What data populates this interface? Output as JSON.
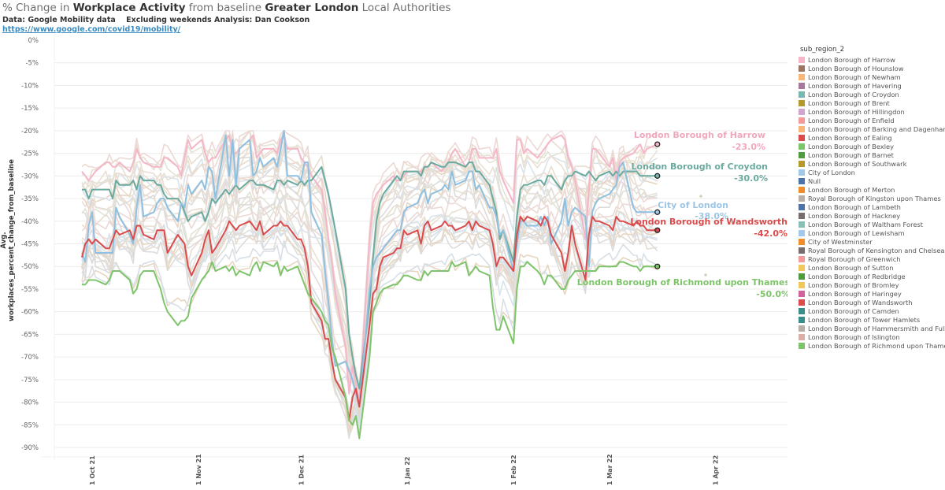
{
  "header": {
    "title_parts": [
      {
        "text": "% Change in ",
        "bold": false
      },
      {
        "text": "Workplace Activity",
        "bold": true
      },
      {
        "text": " from baseline ",
        "bold": false
      },
      {
        "text": "Greater London",
        "bold": true
      },
      {
        "text": " Local Authorities",
        "bold": false
      }
    ],
    "data_source": "Data: Google Mobility data",
    "note": "Excluding weekends Analysis: Dan Cookson",
    "link": "https://www.google.com/covid19/mobility/"
  },
  "legend": {
    "title": "sub_region_2",
    "items": [
      {
        "label": "London Borough of Harrow",
        "color": "#f4b6c8"
      },
      {
        "label": "London Borough of Hounslow",
        "color": "#9c7560"
      },
      {
        "label": "London Borough of Newham",
        "color": "#f8b679"
      },
      {
        "label": "London Borough of Havering",
        "color": "#a6799c"
      },
      {
        "label": "London Borough of Croydon",
        "color": "#79b8b1"
      },
      {
        "label": "London Borough of Brent",
        "color": "#b49a2a"
      },
      {
        "label": "London Borough of Hillingdon",
        "color": "#d1a6cc"
      },
      {
        "label": "London Borough of Enfield",
        "color": "#f59a9a"
      },
      {
        "label": "London Borough of Barking and Dagenham",
        "color": "#f8b679"
      },
      {
        "label": "London Borough of Ealing",
        "color": "#dc4b4b"
      },
      {
        "label": "London Borough of Bexley",
        "color": "#7dc46a"
      },
      {
        "label": "London Borough of Barnet",
        "color": "#4f9c3f"
      },
      {
        "label": "London Borough of Southwark",
        "color": "#b49a2a"
      },
      {
        "label": "City of London",
        "color": "#a1c9ea"
      },
      {
        "label": "Null",
        "color": "#4c72a8"
      },
      {
        "label": "London Borough of Merton",
        "color": "#f28d2c"
      },
      {
        "label": "Royal Borough of Kingston upon Thames",
        "color": "#b9afa9"
      },
      {
        "label": "London Borough of Lambeth",
        "color": "#4c72a8"
      },
      {
        "label": "London Borough of Hackney",
        "color": "#766e6c"
      },
      {
        "label": "London Borough of Waltham Forest",
        "color": "#89c0b5"
      },
      {
        "label": "London Borough of Lewisham",
        "color": "#a1c9ea"
      },
      {
        "label": "City of Westminster",
        "color": "#f28d2c"
      },
      {
        "label": "Royal Borough of Kensington and Chelsea",
        "color": "#766e6c"
      },
      {
        "label": "Royal Borough of Greenwich",
        "color": "#f59a9a"
      },
      {
        "label": "London Borough of Sutton",
        "color": "#f0c95a"
      },
      {
        "label": "London Borough of Redbridge",
        "color": "#4f9c3f"
      },
      {
        "label": "London Borough of Bromley",
        "color": "#f0c95a"
      },
      {
        "label": "London Borough of Haringey",
        "color": "#d1639a"
      },
      {
        "label": "London Borough of Wandsworth",
        "color": "#dc4b4b"
      },
      {
        "label": "London Borough of Camden",
        "color": "#3a8e8a"
      },
      {
        "label": "London Borough of Tower Hamlets",
        "color": "#3a8e8a"
      },
      {
        "label": "London Borough of Hammersmith and Fulham",
        "color": "#b9afa9"
      },
      {
        "label": "London Borough of Islington",
        "color": "#d8b0a8"
      },
      {
        "label": "London Borough of Richmond upon Thames",
        "color": "#7dc46a"
      }
    ]
  },
  "chart_data": {
    "type": "line",
    "title": "% Change in Workplace Activity from baseline Greater London Local Authorities",
    "xlabel": "",
    "ylabel": "Avg. workplaces_percent_change_from_baseline",
    "ylim": [
      -90,
      0
    ],
    "yticks": [
      0,
      -5,
      -10,
      -15,
      -20,
      -25,
      -30,
      -35,
      -40,
      -45,
      -50,
      -55,
      -60,
      -65,
      -70,
      -75,
      -80,
      -85,
      -90
    ],
    "ytick_labels": [
      "0%",
      "-5%",
      "-10%",
      "-15%",
      "-20%",
      "-25%",
      "-30%",
      "-35%",
      "-40%",
      "-45%",
      "-50%",
      "-55%",
      "-60%",
      "-65%",
      "-70%",
      "-75%",
      "-80%",
      "-85%",
      "-90%"
    ],
    "xlim_days": [
      -10,
      205
    ],
    "xticks_days": [
      0,
      31,
      61,
      92,
      123,
      151,
      182
    ],
    "xtick_labels": [
      "1 Oct 21",
      "1 Nov 21",
      "1 Dec 21",
      "1 Jan 22",
      "1 Feb 22",
      "1 Mar 22",
      "1 Apr 22"
    ],
    "x_day_note": "days since 1 Oct 2021",
    "grid": true,
    "legend_position": "right",
    "x": [
      -3,
      -2,
      -1,
      0,
      1,
      4,
      5,
      6,
      7,
      8,
      11,
      12,
      13,
      14,
      15,
      18,
      19,
      20,
      21,
      22,
      25,
      26,
      27,
      28,
      29,
      32,
      33,
      34,
      35,
      36,
      39,
      40,
      41,
      42,
      43,
      46,
      47,
      48,
      49,
      50,
      53,
      54,
      55,
      56,
      57,
      60,
      61,
      62,
      63,
      64,
      67,
      68,
      69,
      70,
      71,
      74,
      75,
      76,
      77,
      78,
      81,
      82,
      83,
      84,
      85,
      88,
      89,
      90,
      91,
      92,
      95,
      96,
      97,
      98,
      99,
      102,
      103,
      104,
      105,
      106,
      109,
      110,
      111,
      112,
      113,
      116,
      117,
      118,
      119,
      120,
      123,
      124,
      125,
      126,
      127,
      130,
      131,
      132,
      133,
      134,
      137,
      138,
      139,
      140,
      141,
      144,
      145,
      146,
      147,
      148,
      151,
      152,
      153,
      154,
      155,
      158,
      159,
      160,
      161,
      162,
      165
    ],
    "series": [
      {
        "name": "London Borough of Harrow",
        "highlight": true,
        "color": "#f4b6c8",
        "end_label": "-23.0%",
        "values": [
          -29,
          -30,
          -31,
          -30,
          -29,
          -27,
          -27,
          -28,
          -28,
          -27,
          -29,
          -27,
          -24,
          -26,
          -27,
          -28,
          -28,
          -28,
          -26,
          -26,
          -28,
          -30,
          -26,
          -22,
          -24,
          -22,
          -25,
          -27,
          -26,
          -26,
          -22,
          -21,
          -25,
          -25,
          -24,
          -22,
          -21,
          -26,
          -25,
          -24,
          -24,
          -25,
          -22,
          -21,
          -24,
          -24,
          -26,
          -27,
          -28,
          -30,
          -33,
          -38,
          -44,
          -49,
          -56,
          -68,
          -78,
          -72,
          -76,
          -80,
          -44,
          -36,
          -34,
          -33,
          -32,
          -30,
          -31,
          -31,
          -30,
          -29,
          -29,
          -29,
          -28,
          -28,
          -27,
          -29,
          -28,
          -27,
          -25,
          -24,
          -28,
          -27,
          -24,
          -24,
          -26,
          -26,
          -26,
          -24,
          -29,
          -31,
          -36,
          -22,
          -22,
          -25,
          -24,
          -26,
          -25,
          -24,
          -23,
          -22,
          -21,
          -22,
          -26,
          -28,
          -31,
          -44,
          -33,
          -24,
          -24,
          -25,
          -28,
          -26,
          -31,
          -27,
          -26,
          -25,
          -24,
          -23,
          -25,
          -24,
          -23
        ]
      },
      {
        "name": "London Borough of Croydon",
        "highlight": true,
        "color": "#79b8b1",
        "end_label": "-30.0%",
        "values": [
          -33,
          -33,
          -35,
          -33,
          -33,
          -33,
          -33,
          -35,
          -31,
          -32,
          -32,
          -31,
          -33,
          -30,
          -31,
          -31,
          -32,
          -32,
          -34,
          -35,
          -35,
          -36,
          -38,
          -40,
          -39,
          -38,
          -40,
          -38,
          -35,
          -36,
          -33,
          -34,
          -33,
          -32,
          -33,
          -31,
          -31,
          -32,
          -32,
          -32,
          -33,
          -31,
          -31,
          -32,
          -31,
          -32,
          -31,
          -32,
          -31,
          -31,
          -28,
          -31,
          -34,
          -38,
          -42,
          -55,
          -65,
          -70,
          -74,
          -77,
          -58,
          -48,
          -40,
          -36,
          -34,
          -31,
          -30,
          -31,
          -29,
          -29,
          -29,
          -30,
          -28,
          -28,
          -27,
          -28,
          -28,
          -27,
          -27,
          -27,
          -28,
          -27,
          -27,
          -29,
          -29,
          -32,
          -35,
          -38,
          -44,
          -42,
          -49,
          -39,
          -33,
          -32,
          -32,
          -31,
          -31,
          -32,
          -30,
          -30,
          -33,
          -31,
          -30,
          -30,
          -29,
          -30,
          -29,
          -30,
          -31,
          -30,
          -29,
          -30,
          -29,
          -30,
          -29,
          -29,
          -29,
          -30,
          -30,
          -30,
          -30
        ]
      },
      {
        "name": "City of London",
        "highlight": true,
        "color": "#a1c9ea",
        "end_label": "-38.0%",
        "values": [
          -47,
          -49,
          -41,
          -38,
          -47,
          -47,
          -47,
          -47,
          -37,
          -39,
          -43,
          -45,
          -37,
          -32,
          -39,
          -38,
          -36,
          -35,
          -35,
          -37,
          -40,
          -36,
          -37,
          -32,
          -34,
          -31,
          -33,
          -28,
          -29,
          -35,
          -21,
          -30,
          -22,
          -32,
          -24,
          -22,
          -30,
          -29,
          -26,
          -28,
          -26,
          -28,
          -24,
          -20,
          -30,
          -30,
          -31,
          -27,
          -27,
          -38,
          -43,
          -51,
          -58,
          -66,
          -72,
          -71,
          -73,
          -75,
          -78,
          -81,
          -55,
          -50,
          -48,
          -47,
          -46,
          -43,
          -42,
          -42,
          -38,
          -37,
          -36,
          -34,
          -33,
          -36,
          -34,
          -33,
          -32,
          -33,
          -29,
          -32,
          -31,
          -29,
          -29,
          -33,
          -32,
          -37,
          -37,
          -39,
          -43,
          -42,
          -51,
          -45,
          -40,
          -40,
          -41,
          -41,
          -39,
          -41,
          -39,
          -45,
          -40,
          -35,
          -41,
          -38,
          -37,
          -39,
          -50,
          -38,
          -36,
          -35,
          -34,
          -33,
          -32,
          -28,
          -27,
          -37,
          -38,
          -38,
          -38,
          -38,
          -38
        ]
      },
      {
        "name": "London Borough of Wandsworth",
        "highlight": true,
        "color": "#dc4b4b",
        "end_label": "-42.0%",
        "values": [
          -48,
          -45,
          -44,
          -45,
          -44,
          -46,
          -46,
          -44,
          -42,
          -43,
          -42,
          -44,
          -41,
          -41,
          -43,
          -44,
          -42,
          -42,
          -42,
          -47,
          -43,
          -44,
          -45,
          -50,
          -52,
          -47,
          -44,
          -42,
          -47,
          -46,
          -42,
          -40,
          -41,
          -42,
          -41,
          -40,
          -41,
          -42,
          -40,
          -43,
          -41,
          -41,
          -40,
          -41,
          -41,
          -44,
          -44,
          -46,
          -50,
          -58,
          -62,
          -66,
          -66,
          -71,
          -75,
          -79,
          -84,
          -79,
          -77,
          -81,
          -63,
          -56,
          -55,
          -50,
          -48,
          -47,
          -46,
          -46,
          -42,
          -43,
          -42,
          -45,
          -41,
          -40,
          -42,
          -41,
          -40,
          -41,
          -41,
          -42,
          -41,
          -40,
          -42,
          -40,
          -41,
          -42,
          -45,
          -50,
          -48,
          -48,
          -51,
          -43,
          -39,
          -40,
          -39,
          -40,
          -41,
          -39,
          -40,
          -43,
          -47,
          -51,
          -47,
          -41,
          -45,
          -53,
          -43,
          -39,
          -40,
          -40,
          -41,
          -42,
          -39,
          -40,
          -40,
          -41,
          -40,
          -41,
          -41,
          -42,
          -42
        ]
      },
      {
        "name": "London Borough of Richmond upon Thames",
        "highlight": true,
        "color": "#7dc46a",
        "end_label": "-50.0%",
        "values": [
          -54,
          -54,
          -53,
          -53,
          -53,
          -54,
          -53,
          -51,
          -51,
          -51,
          -53,
          -56,
          -55,
          -52,
          -51,
          -51,
          -53,
          -55,
          -58,
          -60,
          -63,
          -62,
          -62,
          -61,
          -57,
          -53,
          -52,
          -51,
          -49,
          -51,
          -50,
          -51,
          -50,
          -52,
          -51,
          -52,
          -50,
          -49,
          -51,
          -49,
          -50,
          -49,
          -52,
          -50,
          -51,
          -50,
          -52,
          -54,
          -56,
          -57,
          -60,
          -62,
          -63,
          -68,
          -70,
          -79,
          -84,
          -85,
          -83,
          -88,
          -70,
          -60,
          -58,
          -56,
          -55,
          -54,
          -54,
          -53,
          -52,
          -52,
          -53,
          -53,
          -51,
          -52,
          -51,
          -51,
          -51,
          -51,
          -49,
          -50,
          -49,
          -52,
          -51,
          -50,
          -51,
          -52,
          -59,
          -64,
          -64,
          -61,
          -67,
          -55,
          -50,
          -50,
          -49,
          -51,
          -52,
          -54,
          -52,
          -52,
          -55,
          -55,
          -53,
          -52,
          -51,
          -51,
          -51,
          -51,
          -51,
          -50,
          -50,
          -50,
          -50,
          -49,
          -49,
          -50,
          -50,
          -51,
          -50,
          -50,
          -50
        ]
      }
    ],
    "background_series_count": 29,
    "annotations": [
      {
        "text": "London Borough of Harrow",
        "value": "-23.0%"
      },
      {
        "text": "London Borough of Croydon",
        "value": "-30.0%"
      },
      {
        "text": "City of London",
        "value": "-38.0%"
      },
      {
        "text": "London Borough of Wandsworth",
        "value": "-42.0%"
      },
      {
        "text": "London Borough of Richmond upon Thames",
        "value": "-50.0%"
      }
    ]
  }
}
